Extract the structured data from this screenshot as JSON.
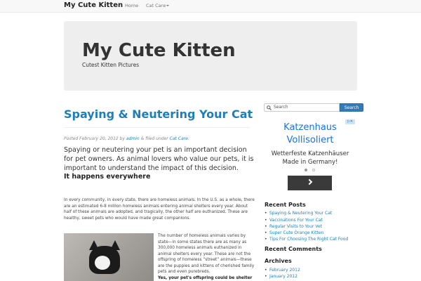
{
  "navbar": {
    "brand": "My Cute Kitten",
    "home": "Home",
    "cat_care": "Cat Care"
  },
  "header": {
    "title": "My Cute Kitten",
    "tagline": "Cutest Kitten Pictures"
  },
  "post": {
    "title": "Spaying & Neutering Your Cat",
    "meta_prefix": "Posted February 20, 2012 by ",
    "author": "admin",
    "meta_mid": " & filed under ",
    "category": "Cat Care",
    "meta_end": ".",
    "lead": "Spaying or neutering your pet is an important decision for pet owners. As animal lovers who value our pets, it is important to understand the impact of this decision.",
    "subhead": "It happens everywhere",
    "para1": "In every community, in every state, there are homeless animals. In the U.S. as a whole, there are an estimated 6-8 million homeless animals entering animal shelters every year. About half of these animals are adopted, and tragically, the other half are euthanized. These are healthy, sweet pets who would have made great companions.",
    "para2": "The number of homeless animals varies by state—in some states there are as many as 300,000 homeless animals euthanized in animal shelters every year. These are not the offspring of homeless “street” animals—these are the puppies and kittens of cherished family pets and even purebreds.",
    "para2_bold": "Yes, your pet's offspring could be shelter"
  },
  "sidebar": {
    "search_placeholder": "Search",
    "search_button": "Search",
    "ad": {
      "title_line1": "Katzenhaus",
      "title_line2": "Vollisoliert",
      "text_line1": "Wetterfeste Katzenhäuser",
      "text_line2": "Made in Germany!"
    },
    "recent_posts_heading": "Recent Posts",
    "recent_posts": [
      "Spaying & Neutering Your Cat",
      "Vaccinations For Your Cat",
      "Regular Visits to Your Vet",
      "Super Cute Orange Kitten",
      "Tips For Choosing The Right Cat Food"
    ],
    "recent_comments_heading": "Recent Comments",
    "archives_heading": "Archives",
    "archives": [
      "February 2012",
      "January 2012"
    ]
  }
}
